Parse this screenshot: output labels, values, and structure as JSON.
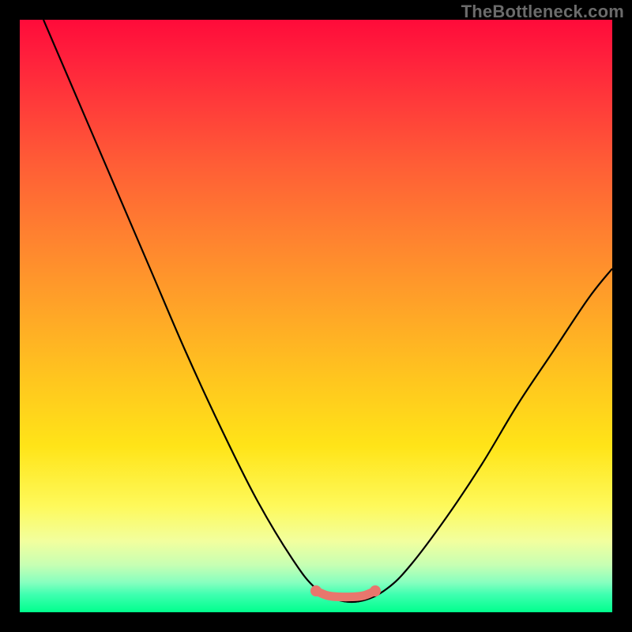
{
  "watermark": "TheBottleneck.com",
  "chart_data": {
    "type": "line",
    "title": "",
    "xlabel": "",
    "ylabel": "",
    "xlim": [
      0,
      100
    ],
    "ylim": [
      0,
      100
    ],
    "series": [
      {
        "name": "bottleneck-curve",
        "x": [
          4,
          10,
          16,
          22,
          28,
          34,
          40,
          46,
          50,
          54,
          58,
          62,
          66,
          72,
          78,
          84,
          90,
          96,
          100
        ],
        "values": [
          100,
          86,
          72,
          58,
          44,
          31,
          19,
          9,
          4,
          2,
          2,
          4,
          8,
          16,
          25,
          35,
          44,
          53,
          58
        ]
      },
      {
        "name": "optimal-range-marker",
        "x": [
          50,
          52,
          54,
          56,
          58,
          60
        ],
        "values": [
          3.6,
          2.8,
          2.6,
          2.6,
          2.8,
          3.6
        ]
      }
    ],
    "gradient_scale": {
      "top_color": "#ff0b3a",
      "bottom_color": "#00ff8d",
      "meaning_top": "high-bottleneck",
      "meaning_bottom": "no-bottleneck"
    }
  }
}
